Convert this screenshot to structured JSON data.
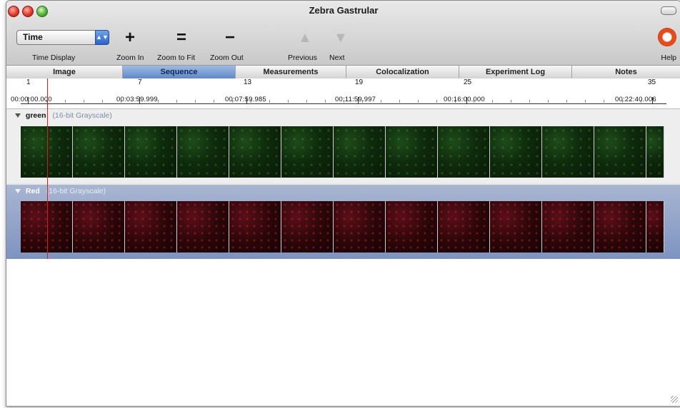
{
  "window": {
    "title": "Zebra Gastrular"
  },
  "toolbar": {
    "time_display_value": "Time",
    "time_display_label": "Time Display",
    "zoom_in_label": "Zoom In",
    "zoom_to_fit_label": "Zoom to Fit",
    "zoom_out_label": "Zoom Out",
    "previous_label": "Previous",
    "next_label": "Next",
    "help_label": "Help"
  },
  "tabs": [
    {
      "label": "Image"
    },
    {
      "label": "Sequence"
    },
    {
      "label": "Measurements"
    },
    {
      "label": "Colocalization"
    },
    {
      "label": "Experiment Log"
    },
    {
      "label": "Notes"
    }
  ],
  "active_tab": "Sequence",
  "ruler": {
    "frames": [
      "1",
      "7",
      "13",
      "19",
      "25",
      "35"
    ],
    "times": [
      "00:00:00.000",
      "00:03:59.999",
      "00:07:59.985",
      "00:11:59.997",
      "00:16:00.000",
      "00:22:40.006"
    ]
  },
  "tracks": [
    {
      "name": "green",
      "format": "(16-bit Grayscale)",
      "color": "#2e6f22"
    },
    {
      "name": "Red",
      "format": "(16-bit Grayscale)",
      "color": "#a3111e"
    }
  ],
  "colors": {
    "accent": "#5f88c9",
    "playhead": "#e11a1a"
  },
  "icons": {
    "zoom_in": "plus-icon",
    "zoom_fit": "equals-icon",
    "zoom_out": "minus-icon",
    "previous": "chevron-up-icon",
    "next": "chevron-down-icon",
    "help": "lifebuoy-icon"
  }
}
